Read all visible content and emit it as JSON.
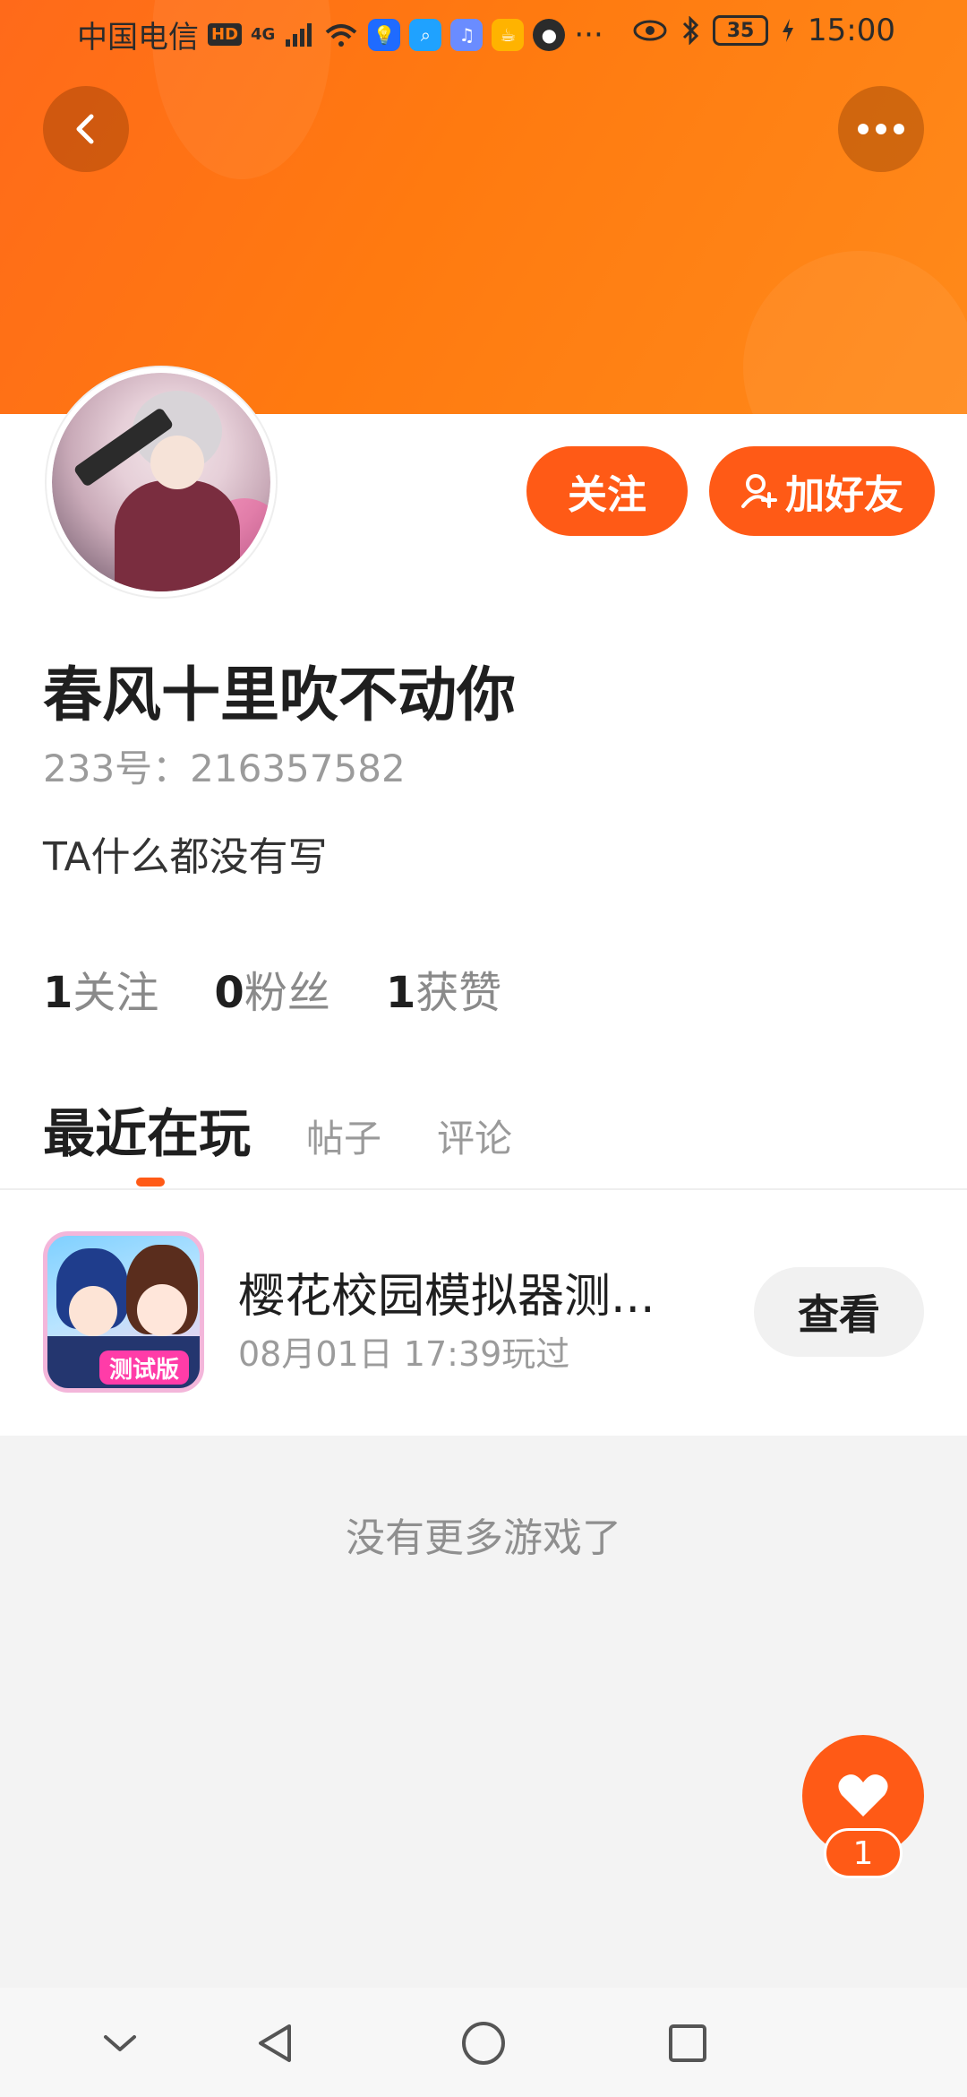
{
  "status_bar": {
    "carrier": "中国电信",
    "hd": "HD",
    "network": "4G",
    "more": "···",
    "battery": "35",
    "time": "15:00"
  },
  "profile": {
    "name": "春风十里吹不动你",
    "id_text": "233号：216357582",
    "bio": "TA什么都没有写",
    "follow_label": "关注",
    "add_friend_label": "加好友"
  },
  "stats": [
    {
      "num": "1",
      "label": "关注"
    },
    {
      "num": "0",
      "label": "粉丝"
    },
    {
      "num": "1",
      "label": "获赞"
    }
  ],
  "tabs": {
    "active": "最近在玩",
    "posts": "帖子",
    "comments": "评论"
  },
  "game": {
    "title": "樱花校园模拟器测...",
    "played": "08月01日 17:39玩过",
    "view_label": "查看",
    "badge": "测试版"
  },
  "no_more_text": "没有更多游戏了",
  "like": {
    "count": "1"
  },
  "colors": {
    "accent": "#ff5a16",
    "banner": "#ff7a10"
  }
}
